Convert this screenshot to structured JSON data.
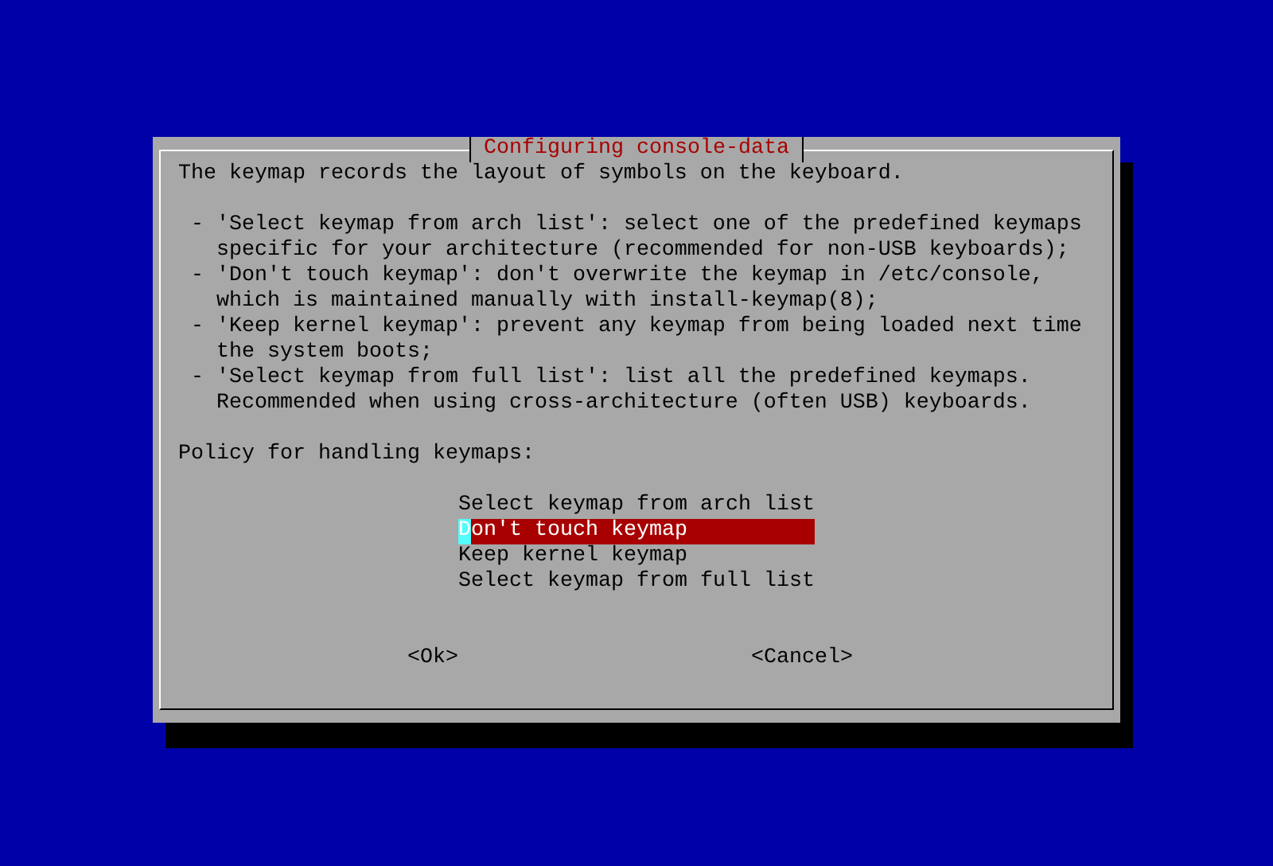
{
  "dialog": {
    "title": "Configuring console-data",
    "intro": "The keymap records the layout of symbols on the keyboard.",
    "bullets": [
      {
        "lines": [
          "- 'Select keymap from arch list': select one of the predefined keymaps",
          "specific for your architecture (recommended for non-USB keyboards);"
        ]
      },
      {
        "lines": [
          "- 'Don't touch keymap': don't overwrite the keymap in /etc/console,",
          "which is maintained manually with install-keymap(8);"
        ]
      },
      {
        "lines": [
          "- 'Keep kernel keymap': prevent any keymap from being loaded next time",
          "the system boots;"
        ]
      },
      {
        "lines": [
          "- 'Select keymap from full list': list all the predefined keymaps.",
          "Recommended when using cross-architecture (often USB) keyboards."
        ]
      }
    ],
    "prompt": "Policy for handling keymaps:",
    "options": [
      {
        "label": "Select keymap from arch list",
        "selected": false
      },
      {
        "label": "Don't touch keymap",
        "selected": true
      },
      {
        "label": "Keep kernel keymap",
        "selected": false
      },
      {
        "label": "Select keymap from full list",
        "selected": false
      }
    ],
    "buttons": [
      "<Ok>",
      "<Cancel>"
    ]
  }
}
